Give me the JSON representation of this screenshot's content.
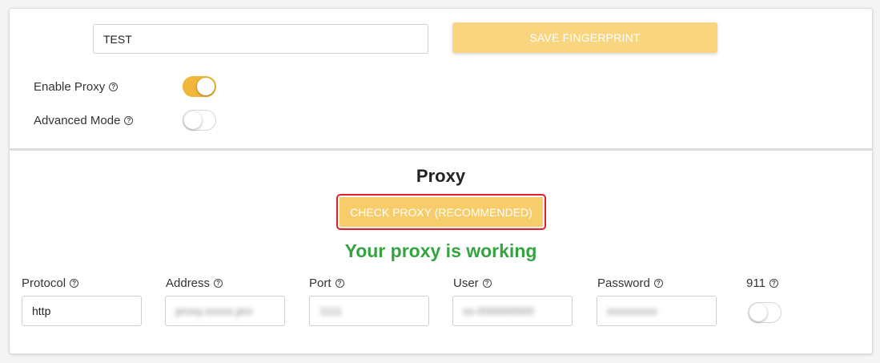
{
  "fingerprint": {
    "name_value": "TEST",
    "save_label": "SAVE FINGERPRINT"
  },
  "options": {
    "enable_proxy": {
      "label": "Enable Proxy",
      "on": true
    },
    "advanced_mode": {
      "label": "Advanced Mode",
      "on": false
    }
  },
  "proxy": {
    "title": "Proxy",
    "check_label": "CHECK PROXY (RECOMMENDED)",
    "status": "Your proxy is working",
    "fields": {
      "protocol": {
        "label": "Protocol",
        "value": "http"
      },
      "address": {
        "label": "Address",
        "value": "proxy.xxxxx.pro"
      },
      "port": {
        "label": "Port",
        "value": "1111"
      },
      "user": {
        "label": "User",
        "value": "xx-000000000"
      },
      "password": {
        "label": "Password",
        "value": "xxxxxxxxx"
      },
      "n911": {
        "label": "911",
        "on": false
      }
    }
  },
  "icons": {
    "help": "?"
  },
  "colors": {
    "accent": "#f0b73a",
    "button": "#f9d57f",
    "success": "#34a340",
    "highlight": "#e0202a"
  }
}
